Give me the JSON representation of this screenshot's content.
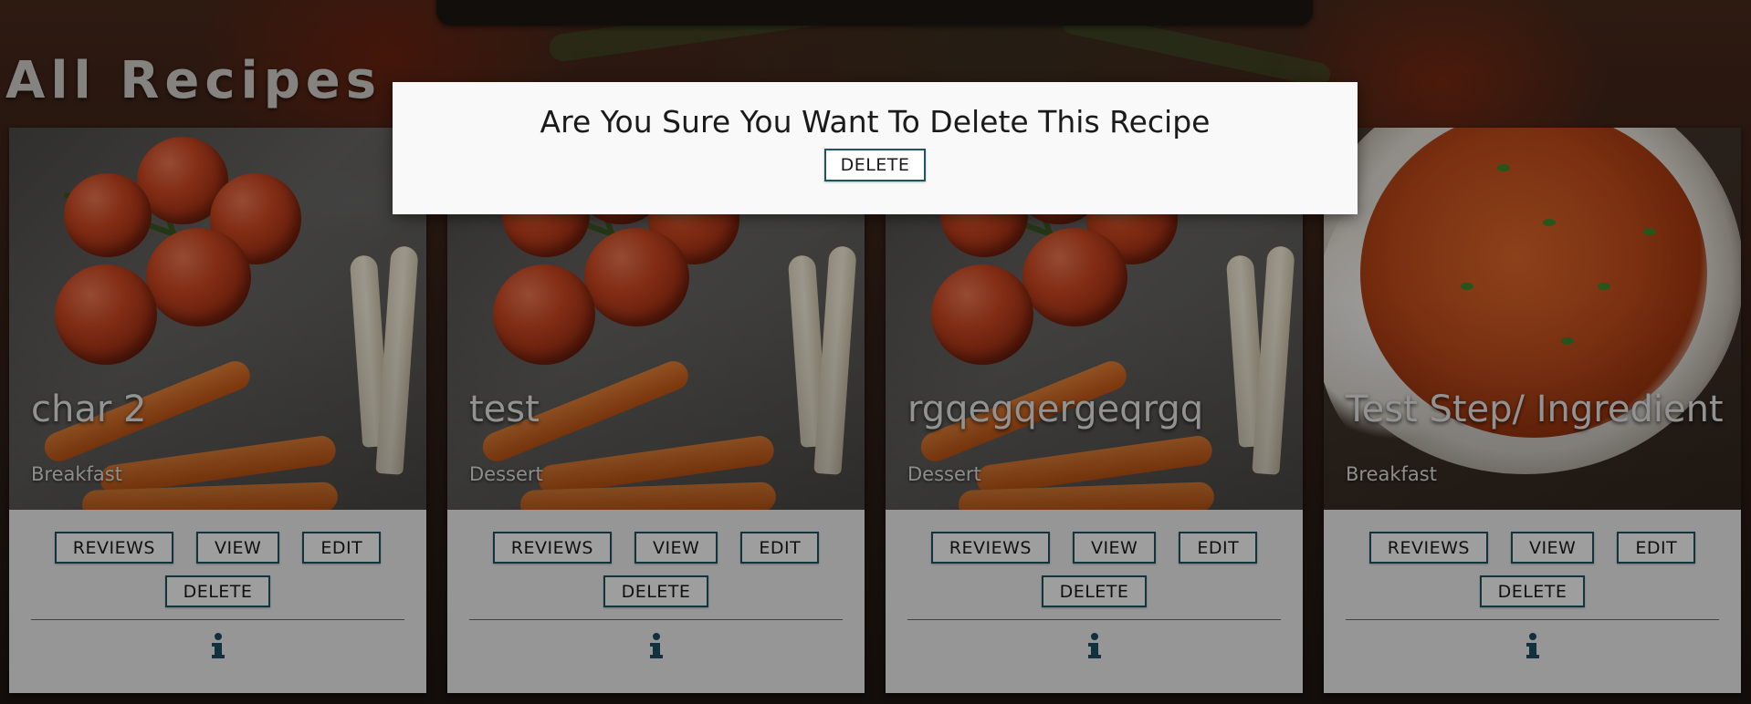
{
  "page": {
    "title": "All Recipes"
  },
  "modal": {
    "title": "Are You Sure You Want To Delete This Recipe",
    "delete_label": "DELETE"
  },
  "cards": [
    {
      "title": "char 2",
      "category": "Breakfast",
      "image": "vegetables-photo",
      "reviews_label": "REVIEWS",
      "view_label": "VIEW",
      "edit_label": "EDIT",
      "delete_label": "DELETE"
    },
    {
      "title": "test",
      "category": "Dessert",
      "image": "vegetables-photo",
      "reviews_label": "REVIEWS",
      "view_label": "VIEW",
      "edit_label": "EDIT",
      "delete_label": "DELETE"
    },
    {
      "title": "rgqegqergeqrgq",
      "category": "Dessert",
      "image": "vegetables-photo",
      "reviews_label": "REVIEWS",
      "view_label": "VIEW",
      "edit_label": "EDIT",
      "delete_label": "DELETE"
    },
    {
      "title": "Test Step/ Ingredient",
      "category": "Breakfast",
      "image": "curry-photo",
      "reviews_label": "REVIEWS",
      "view_label": "VIEW",
      "edit_label": "EDIT",
      "delete_label": "DELETE"
    }
  ],
  "icons": {
    "info": "info-icon"
  },
  "colors": {
    "button_border": "#1e5560",
    "info_icon": "#1d4e63",
    "modal_background": "#f9f9f9"
  }
}
